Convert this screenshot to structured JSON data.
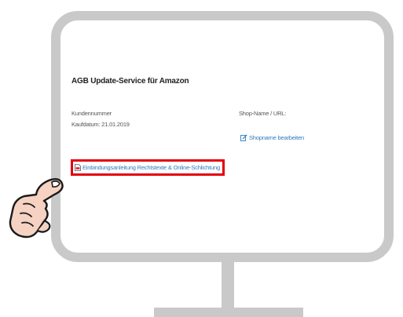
{
  "screen": {
    "product_title": "AGB Update-Service für Amazon",
    "customer_number_label": "Kundennummer",
    "purchase_date_text": "Kaufdatum: 21.01.2019",
    "shop_name_label": "Shop-Name / URL:",
    "edit_shop_link": "Shopname bearbeiten",
    "guide_link": "Einbindungsanleitung Rechtstexte & Online-Schlichtung"
  },
  "colors": {
    "link": "#2f7bbf",
    "highlight_border": "#e3000f",
    "monitor_frame": "#c9c9c9",
    "hand_skin": "#f6d2c2"
  },
  "icons": {
    "guide_link_icon": "pdf-document-icon",
    "edit_shop_icon": "edit-icon",
    "pointer": "pointing-hand-icon"
  }
}
